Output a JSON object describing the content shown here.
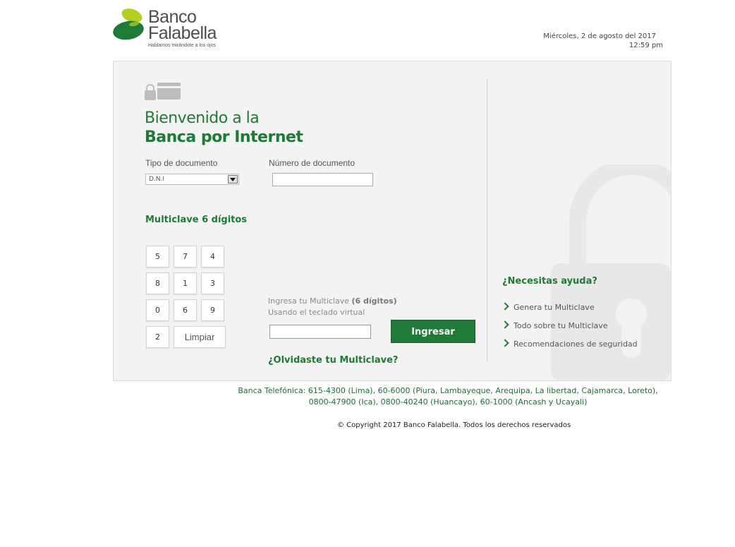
{
  "brand": {
    "name_line1": "Banco",
    "name_line2": "Falabella",
    "tagline": "Hablamos mirándote a los ojos",
    "color_primary": "#1e7a35",
    "color_accent": "#a8c832"
  },
  "header": {
    "date": "Miércoles, 2 de agosto del 2017",
    "time": "12:59 pm"
  },
  "login": {
    "icon": "lock-card-icon",
    "welcome_line1": "Bienvenido a la",
    "welcome_line2": "Banca por Internet",
    "doc_type_label": "Tipo de documento",
    "doc_type_value": "D.N.I",
    "doc_number_label": "Número de documento",
    "doc_number_value": "",
    "multiclave_title": "Multiclave 6 dígitos",
    "keypad": [
      "5",
      "7",
      "4",
      "8",
      "1",
      "3",
      "0",
      "6",
      "9",
      "2"
    ],
    "clear_label": "Limpiar",
    "hint_line1_prefix": "Ingresa tu Multiclave ",
    "hint_line1_bold": "(6 dígitos)",
    "hint_line2": "Usando el teclado virtual",
    "multiclave_value": "",
    "submit_label": "Ingresar",
    "forgot_link": "¿Olvidaste tu Multiclave?"
  },
  "help": {
    "title": "¿Necesitas ayuda?",
    "items": [
      "Genera tu Multiclave",
      "Todo sobre tu Multiclave",
      "Recomendaciones de seguridad"
    ]
  },
  "footer": {
    "phone_line1": "Banca Telefónica: 615-4300 (Lima), 60-6000 (Piura, Lambayeque, Arequipa, La libertad, Cajamarca, Loreto),",
    "phone_line2": "0800-47900 (Ica), 0800-40240 (Huancayo), 60-1000 (Ancash y Ucayali)",
    "copyright": "© Copyright 2017 Banco Falabella. Todos los derechos reservados"
  }
}
